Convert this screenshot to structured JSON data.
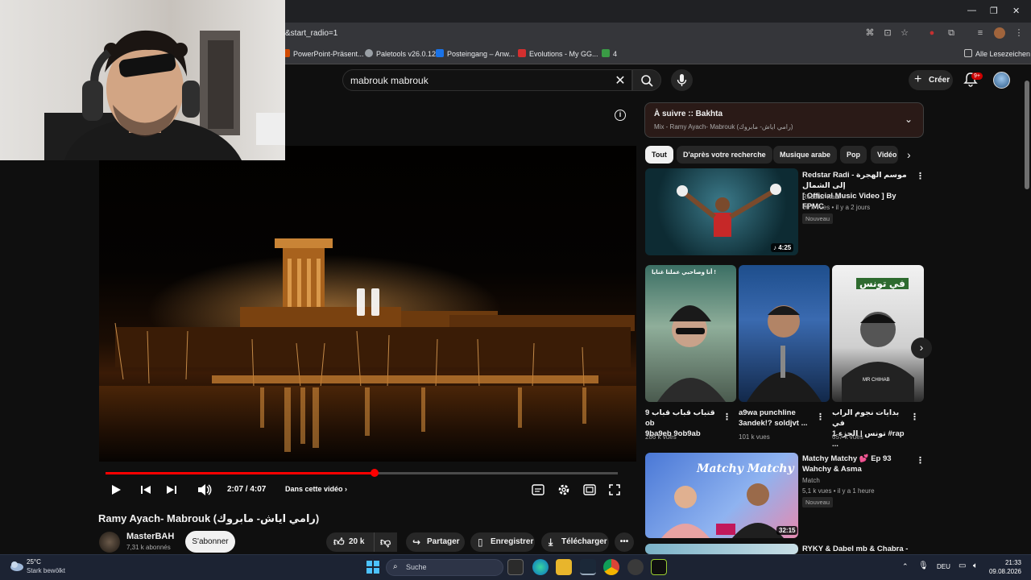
{
  "browser": {
    "url": "&start_radio=1",
    "bookmarks": [
      "PowerPoint-Präsent...",
      "Paletools v26.0.12",
      "Posteingang – Anw...",
      "Evolutions - My GG...",
      "4"
    ],
    "all_bookmarks": "Alle Lesezeichen"
  },
  "header": {
    "search_value": "mabrouk mabrouk",
    "create_label": "Créer",
    "notif_badge": "9+"
  },
  "player": {
    "time": "2:07 / 4:07",
    "progress": 0.525,
    "chapter": "Dans cette vidéo"
  },
  "video": {
    "title": "Ramy Ayach- Mabrouk (رامي اياش- مابروك)",
    "channel": "MasterBAH",
    "subs": "7,31 k abonnés",
    "subscribe": "S'abonner",
    "likes": "20 k",
    "share": "Partager",
    "save": "Enregistrer",
    "download": "Télécharger"
  },
  "up_next": {
    "title": "À suivre :: Bakhta",
    "subtitle": "Mix - Ramy Ayach- Mabrouk (رامي اياش- مابروك)"
  },
  "chips": [
    "Tout",
    "D'après votre recherche",
    "Musique arabe",
    "Pop",
    "Vidéo"
  ],
  "feed": {
    "first": {
      "title_line1": "Redstar Radi - موسم الهجرة إلى الشمال",
      "title_line2": "[ Official Music Video ] By FPMC",
      "channel": "Redstar Radi",
      "meta": "66 k vues • il y a 2 jours",
      "badge": "Nouveau",
      "duration": "4:25"
    },
    "shorts": [
      {
        "title1": "9 قتباب قباب قباب ob",
        "title2": "9ba9eb 9ob9ab",
        "views": "286 k vues"
      },
      {
        "title1": "a9wa punchline",
        "title2": "3andek!? soldjvt ...",
        "views": "101 k vues"
      },
      {
        "title1": "بدايات نجوم الراب في",
        "title2": "1 تونس | الجزء #rap ...",
        "views": "657 k vues"
      }
    ],
    "short_overlays": {
      "s1_top": "أنا وصاحبي عملنا غنايا !",
      "s3_top": "في تونس",
      "s3_name": "MR CHIHAB"
    },
    "third": {
      "title_line1": "Matchy Matchy 💕 Ep 93",
      "title_line2": "Wahchy & Asma",
      "channel": "Match",
      "meta": "5,1 k vues • il y a 1 heure",
      "badge": "Nouveau",
      "duration": "32:15",
      "thumb_text": "Matchy Matchy"
    },
    "fourth": {
      "title_line1": "RYKY & Dabel mb & Chabra -"
    }
  },
  "taskbar": {
    "temp": "25°C",
    "weather": "Stark bewölkt",
    "search": "Suche",
    "lang": "DEU",
    "time": "21:33",
    "date": "09.08.2026"
  }
}
